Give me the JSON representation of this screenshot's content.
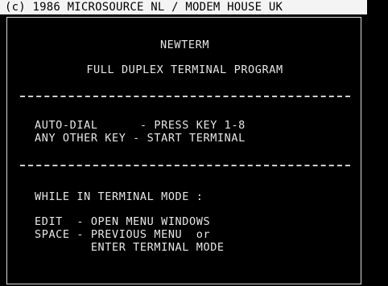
{
  "header": {
    "copyright": "(c) 1986 MICROSOURCE NL / MODEM HOUSE UK"
  },
  "screen": {
    "title": "NEWTERM",
    "subtitle": "FULL DUPLEX TERMINAL PROGRAM",
    "divider": "------------------------------------------------",
    "menu": {
      "autodial_line": "AUTO-DIAL      - PRESS KEY 1-8",
      "otherkey_line": "ANY OTHER KEY - START TERMINAL"
    },
    "help": {
      "heading": "WHILE IN TERMINAL MODE :",
      "edit_line": "EDIT  - OPEN MENU WINDOWS",
      "space_line1": "SPACE - PREVIOUS MENU  or",
      "space_line2": "        ENTER TERMINAL MODE"
    }
  },
  "colors": {
    "background": "#000000",
    "text": "#e6e6e6",
    "header_bg": "#f4f4f4"
  }
}
